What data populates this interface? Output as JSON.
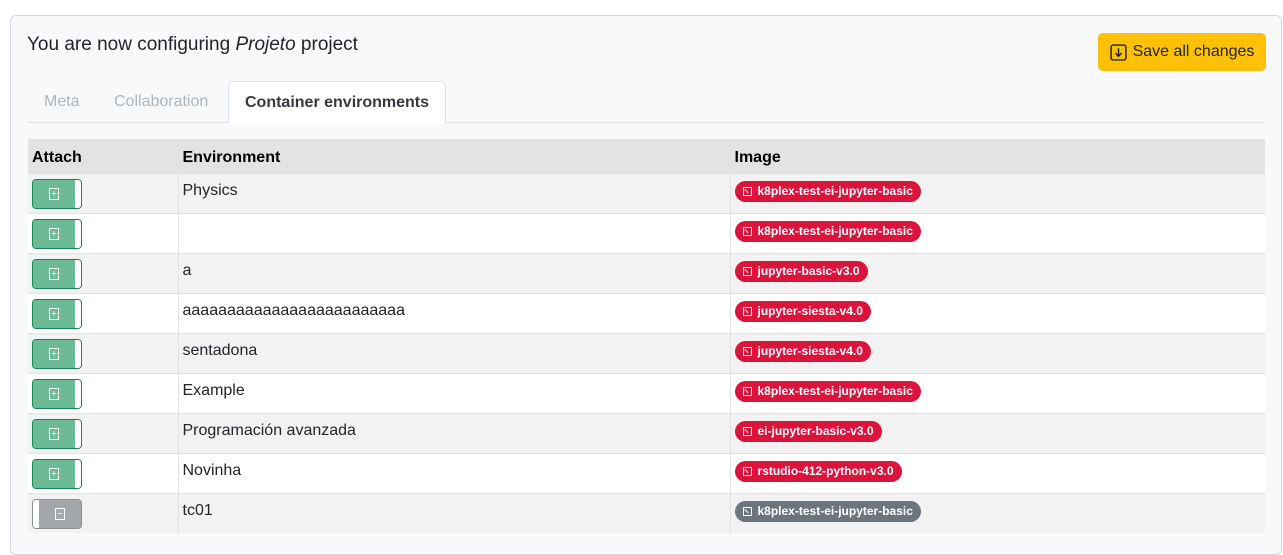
{
  "header": {
    "title_prefix": "You are now configuring ",
    "project_name": "Projeto",
    "title_suffix": " project",
    "save_label": "Save all changes"
  },
  "tabs": [
    {
      "label": "Meta",
      "active": false
    },
    {
      "label": "Collaboration",
      "active": false
    },
    {
      "label": "Container environments",
      "active": true
    }
  ],
  "table": {
    "columns": [
      "Attach",
      "Environment",
      "Image"
    ],
    "rows": [
      {
        "attached": true,
        "environment": "Physics",
        "image": "k8plex-test-ei-jupyter-basic"
      },
      {
        "attached": true,
        "environment": "",
        "image": "k8plex-test-ei-jupyter-basic"
      },
      {
        "attached": true,
        "environment": "a",
        "image": "jupyter-basic-v3.0"
      },
      {
        "attached": true,
        "environment": "aaaaaaaaaaaaaaaaaaaaaaaaa",
        "image": "jupyter-siesta-v4.0"
      },
      {
        "attached": true,
        "environment": "sentadona",
        "image": "jupyter-siesta-v4.0"
      },
      {
        "attached": true,
        "environment": "Example",
        "image": "k8plex-test-ei-jupyter-basic"
      },
      {
        "attached": true,
        "environment": "Programación avanzada",
        "image": "ei-jupyter-basic-v3.0"
      },
      {
        "attached": true,
        "environment": "Novinha",
        "image": "rstudio-412-python-v3.0"
      },
      {
        "attached": false,
        "environment": "tc01",
        "image": "k8plex-test-ei-jupyter-basic"
      }
    ]
  },
  "colors": {
    "save_button": "#ffc107",
    "toggle_on": "#6cbb94",
    "toggle_off": "#a3a7ab",
    "badge_active": "#dc143c",
    "badge_inactive": "#6c757d"
  },
  "icons": {
    "save": "download-box-icon",
    "image_badge": "image-icon",
    "toggle_on": "plus-box-icon",
    "toggle_off": "minus-box-icon"
  }
}
